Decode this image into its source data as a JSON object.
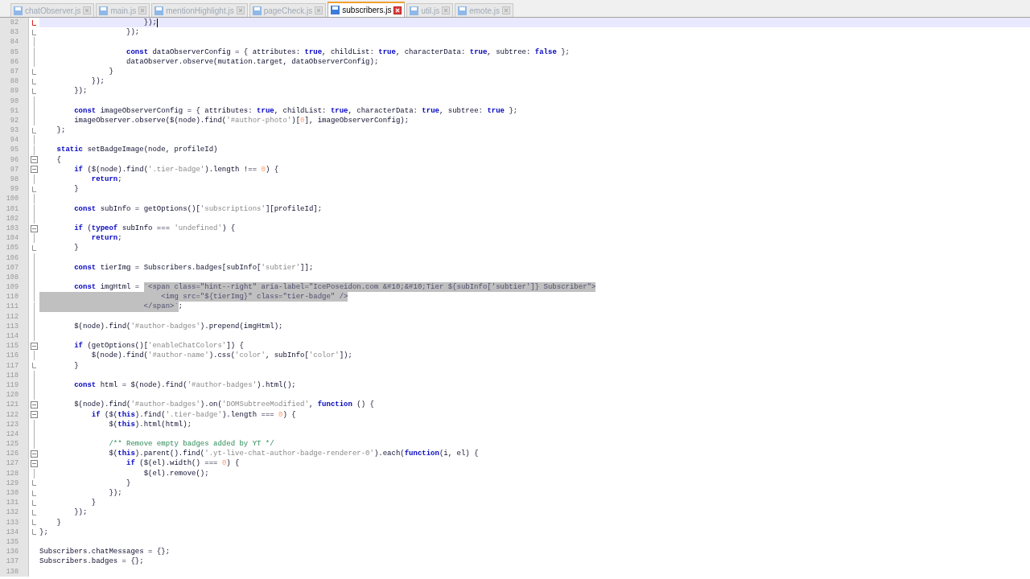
{
  "tabs": [
    {
      "label": "chatObserver.js",
      "selected": false
    },
    {
      "label": "main.js",
      "selected": false
    },
    {
      "label": "mentionHighlight.js",
      "selected": false
    },
    {
      "label": "pageCheck.js",
      "selected": false
    },
    {
      "label": "subscribers.js",
      "selected": true
    },
    {
      "label": "util.js",
      "selected": false
    },
    {
      "label": "emote.js",
      "selected": false
    }
  ],
  "editor": {
    "lines": [
      {
        "number": "82",
        "current": true,
        "kind": "changed-end",
        "code": [
          {
            "text": "                        });",
            "kind": "plain"
          }
        ]
      },
      {
        "number": "83",
        "current": false,
        "kind": "fold-end",
        "code": [
          {
            "text": "                    });",
            "kind": "plain"
          }
        ]
      },
      {
        "number": "84",
        "current": false,
        "kind": "fold-body"
      },
      {
        "number": "85",
        "current": false,
        "kind": "fold-body",
        "code": [
          {
            "text": "                    const",
            "kind": "keyword"
          },
          {
            "text": " dataObserverConfig = { attributes: ",
            "kind": "plain"
          },
          {
            "text": "true",
            "kind": "keyword"
          },
          {
            "text": ", childList: ",
            "kind": "plain"
          },
          {
            "text": "true",
            "kind": "keyword"
          },
          {
            "text": ", characterData: ",
            "kind": "plain"
          },
          {
            "text": "true",
            "kind": "keyword"
          },
          {
            "text": ", subtree: ",
            "kind": "plain"
          },
          {
            "text": "false",
            "kind": "keyword"
          },
          {
            "text": " };",
            "kind": "plain"
          }
        ]
      },
      {
        "number": "86",
        "current": false,
        "kind": "fold-body",
        "code": [
          {
            "text": "                    dataObserver.observe(mutation.target, dataObserverConfig);",
            "kind": "plain"
          }
        ]
      },
      {
        "number": "87",
        "current": false,
        "kind": "fold-end",
        "code": [
          {
            "text": "                }",
            "kind": "plain"
          }
        ]
      },
      {
        "number": "88",
        "current": false,
        "kind": "fold-end",
        "code": [
          {
            "text": "            });",
            "kind": "plain"
          }
        ]
      },
      {
        "number": "89",
        "current": false,
        "kind": "fold-end",
        "code": [
          {
            "text": "        });",
            "kind": "plain"
          }
        ]
      },
      {
        "number": "90",
        "current": false,
        "kind": "fold-body"
      },
      {
        "number": "91",
        "current": false,
        "kind": "fold-body",
        "code": [
          {
            "text": "        const",
            "kind": "keyword"
          },
          {
            "text": " imageObserverConfig = { attributes: ",
            "kind": "plain"
          },
          {
            "text": "true",
            "kind": "keyword"
          },
          {
            "text": ", childList: ",
            "kind": "plain"
          },
          {
            "text": "true",
            "kind": "keyword"
          },
          {
            "text": ", characterData: ",
            "kind": "plain"
          },
          {
            "text": "true",
            "kind": "keyword"
          },
          {
            "text": ", subtree: ",
            "kind": "plain"
          },
          {
            "text": "true",
            "kind": "keyword"
          },
          {
            "text": " };",
            "kind": "plain"
          }
        ]
      },
      {
        "number": "92",
        "current": false,
        "kind": "fold-body",
        "code": [
          {
            "text": "        imageObserver.observe($(node).find(",
            "kind": "plain"
          },
          {
            "text": "'#author-photo'",
            "kind": "string"
          },
          {
            "text": ")[",
            "kind": "plain"
          },
          {
            "text": "0",
            "kind": "number"
          },
          {
            "text": "], imageObserverConfig);",
            "kind": "plain"
          }
        ]
      },
      {
        "number": "93",
        "current": false,
        "kind": "fold-end",
        "code": [
          {
            "text": "    };",
            "kind": "plain"
          }
        ]
      },
      {
        "number": "94",
        "current": false,
        "kind": "fold-body"
      },
      {
        "number": "95",
        "current": false,
        "kind": "fold-body",
        "code": [
          {
            "text": "    static",
            "kind": "keyword"
          },
          {
            "text": " setBadgeImage(node, profileId)",
            "kind": "plain"
          }
        ]
      },
      {
        "number": "96",
        "current": false,
        "kind": "fold-start",
        "code": [
          {
            "text": "    {",
            "kind": "plain"
          }
        ]
      },
      {
        "number": "97",
        "current": false,
        "kind": "fold-start",
        "code": [
          {
            "text": "        if",
            "kind": "keyword"
          },
          {
            "text": " ($(node).find(",
            "kind": "plain"
          },
          {
            "text": "'.tier-badge'",
            "kind": "string"
          },
          {
            "text": ").length !== ",
            "kind": "plain"
          },
          {
            "text": "0",
            "kind": "number"
          },
          {
            "text": ") {",
            "kind": "plain"
          }
        ]
      },
      {
        "number": "98",
        "current": false,
        "kind": "fold-body",
        "code": [
          {
            "text": "            return",
            "kind": "keyword"
          },
          {
            "text": ";",
            "kind": "plain"
          }
        ]
      },
      {
        "number": "99",
        "current": false,
        "kind": "fold-end",
        "code": [
          {
            "text": "        }",
            "kind": "plain"
          }
        ]
      },
      {
        "number": "100",
        "current": false,
        "kind": "fold-body"
      },
      {
        "number": "101",
        "current": false,
        "kind": "fold-body",
        "code": [
          {
            "text": "        const",
            "kind": "keyword"
          },
          {
            "text": " subInfo = getOptions()[",
            "kind": "plain"
          },
          {
            "text": "'subscriptions'",
            "kind": "string"
          },
          {
            "text": "][profileId];",
            "kind": "plain"
          }
        ]
      },
      {
        "number": "102",
        "current": false,
        "kind": "fold-body"
      },
      {
        "number": "103",
        "current": false,
        "kind": "fold-start",
        "code": [
          {
            "text": "        if",
            "kind": "keyword"
          },
          {
            "text": " (",
            "kind": "plain"
          },
          {
            "text": "typeof",
            "kind": "keyword"
          },
          {
            "text": " subInfo === ",
            "kind": "plain"
          },
          {
            "text": "'undefined'",
            "kind": "string"
          },
          {
            "text": ") {",
            "kind": "plain"
          }
        ]
      },
      {
        "number": "104",
        "current": false,
        "kind": "fold-body",
        "code": [
          {
            "text": "            return",
            "kind": "keyword"
          },
          {
            "text": ";",
            "kind": "plain"
          }
        ]
      },
      {
        "number": "105",
        "current": false,
        "kind": "fold-end",
        "code": [
          {
            "text": "        }",
            "kind": "plain"
          }
        ]
      },
      {
        "number": "106",
        "current": false,
        "kind": "fold-body"
      },
      {
        "number": "107",
        "current": false,
        "kind": "fold-body",
        "code": [
          {
            "text": "        const",
            "kind": "keyword"
          },
          {
            "text": " tierImg = Subscribers.badges[subInfo[",
            "kind": "plain"
          },
          {
            "text": "'subtier'",
            "kind": "string"
          },
          {
            "text": "]];",
            "kind": "plain"
          }
        ]
      },
      {
        "number": "108",
        "current": false,
        "kind": "fold-body"
      },
      {
        "number": "109",
        "current": false,
        "kind": "fold-body",
        "code": [
          {
            "text": "        const",
            "kind": "keyword"
          },
          {
            "text": " imgHtml = ",
            "kind": "plain"
          },
          {
            "text": "`<span class=\"hint--right\" aria-label=\"IcePoseidon.com &#10;&#10;Tier ${subInfo['subtier']} Subscriber\">",
            "kind": "selection"
          }
        ]
      },
      {
        "number": "110",
        "current": false,
        "kind": "fold-body",
        "code": [
          {
            "text": "                            <img src=\"${tierImg}\" class=\"tier-badge\" />",
            "kind": "selection"
          }
        ]
      },
      {
        "number": "111",
        "current": false,
        "kind": "fold-body",
        "code": [
          {
            "text": "                        </span>`",
            "kind": "selection"
          },
          {
            "text": ";",
            "kind": "plain"
          }
        ]
      },
      {
        "number": "112",
        "current": false,
        "kind": "fold-body"
      },
      {
        "number": "113",
        "current": false,
        "kind": "fold-body",
        "code": [
          {
            "text": "        $(node).find(",
            "kind": "plain"
          },
          {
            "text": "'#author-badges'",
            "kind": "string"
          },
          {
            "text": ").prepend(imgHtml);",
            "kind": "plain"
          }
        ]
      },
      {
        "number": "114",
        "current": false,
        "kind": "fold-body"
      },
      {
        "number": "115",
        "current": false,
        "kind": "fold-start",
        "code": [
          {
            "text": "        if",
            "kind": "keyword"
          },
          {
            "text": " (getOptions()[",
            "kind": "plain"
          },
          {
            "text": "'enableChatColors'",
            "kind": "string"
          },
          {
            "text": "]) {",
            "kind": "plain"
          }
        ]
      },
      {
        "number": "116",
        "current": false,
        "kind": "fold-body",
        "code": [
          {
            "text": "            $(node).find(",
            "kind": "plain"
          },
          {
            "text": "'#author-name'",
            "kind": "string"
          },
          {
            "text": ").css(",
            "kind": "plain"
          },
          {
            "text": "'color'",
            "kind": "string"
          },
          {
            "text": ", subInfo[",
            "kind": "plain"
          },
          {
            "text": "'color'",
            "kind": "string"
          },
          {
            "text": "]);",
            "kind": "plain"
          }
        ]
      },
      {
        "number": "117",
        "current": false,
        "kind": "fold-end",
        "code": [
          {
            "text": "        }",
            "kind": "plain"
          }
        ]
      },
      {
        "number": "118",
        "current": false,
        "kind": "fold-body"
      },
      {
        "number": "119",
        "current": false,
        "kind": "fold-body",
        "code": [
          {
            "text": "        const",
            "kind": "keyword"
          },
          {
            "text": " html = $(node).find(",
            "kind": "plain"
          },
          {
            "text": "'#author-badges'",
            "kind": "string"
          },
          {
            "text": ").html();",
            "kind": "plain"
          }
        ]
      },
      {
        "number": "120",
        "current": false,
        "kind": "fold-body"
      },
      {
        "number": "121",
        "current": false,
        "kind": "fold-start",
        "code": [
          {
            "text": "        $(node).find(",
            "kind": "plain"
          },
          {
            "text": "'#author-badges'",
            "kind": "string"
          },
          {
            "text": ").on(",
            "kind": "plain"
          },
          {
            "text": "'DOMSubtreeModified'",
            "kind": "string"
          },
          {
            "text": ", ",
            "kind": "plain"
          },
          {
            "text": "function",
            "kind": "keyword"
          },
          {
            "text": " () {",
            "kind": "plain"
          }
        ]
      },
      {
        "number": "122",
        "current": false,
        "kind": "fold-start",
        "code": [
          {
            "text": "            if",
            "kind": "keyword"
          },
          {
            "text": " ($(",
            "kind": "plain"
          },
          {
            "text": "this",
            "kind": "keyword"
          },
          {
            "text": ").find(",
            "kind": "plain"
          },
          {
            "text": "'.tier-badge'",
            "kind": "string"
          },
          {
            "text": ").length === ",
            "kind": "plain"
          },
          {
            "text": "0",
            "kind": "number"
          },
          {
            "text": ") {",
            "kind": "plain"
          }
        ]
      },
      {
        "number": "123",
        "current": false,
        "kind": "fold-body",
        "code": [
          {
            "text": "                $(",
            "kind": "plain"
          },
          {
            "text": "this",
            "kind": "keyword"
          },
          {
            "text": ").html(html);",
            "kind": "plain"
          }
        ]
      },
      {
        "number": "124",
        "current": false,
        "kind": "fold-body"
      },
      {
        "number": "125",
        "current": false,
        "kind": "fold-body",
        "code": [
          {
            "text": "                /** Remove empty badges added by YT */",
            "kind": "comment"
          }
        ]
      },
      {
        "number": "126",
        "current": false,
        "kind": "fold-start",
        "code": [
          {
            "text": "                $(",
            "kind": "plain"
          },
          {
            "text": "this",
            "kind": "keyword"
          },
          {
            "text": ").parent().find(",
            "kind": "plain"
          },
          {
            "text": "'.yt-live-chat-author-badge-renderer-0'",
            "kind": "string"
          },
          {
            "text": ").each(",
            "kind": "plain"
          },
          {
            "text": "function",
            "kind": "keyword"
          },
          {
            "text": "(i, el) {",
            "kind": "plain"
          }
        ]
      },
      {
        "number": "127",
        "current": false,
        "kind": "fold-start",
        "code": [
          {
            "text": "                    if",
            "kind": "keyword"
          },
          {
            "text": " ($(el).width() === ",
            "kind": "plain"
          },
          {
            "text": "0",
            "kind": "number"
          },
          {
            "text": ") {",
            "kind": "plain"
          }
        ]
      },
      {
        "number": "128",
        "current": false,
        "kind": "fold-body",
        "code": [
          {
            "text": "                        $(el).remove();",
            "kind": "plain"
          }
        ]
      },
      {
        "number": "129",
        "current": false,
        "kind": "fold-end",
        "code": [
          {
            "text": "                    }",
            "kind": "plain"
          }
        ]
      },
      {
        "number": "130",
        "current": false,
        "kind": "fold-end",
        "code": [
          {
            "text": "                });",
            "kind": "plain"
          }
        ]
      },
      {
        "number": "131",
        "current": false,
        "kind": "fold-end",
        "code": [
          {
            "text": "            }",
            "kind": "plain"
          }
        ]
      },
      {
        "number": "132",
        "current": false,
        "kind": "fold-end",
        "code": [
          {
            "text": "        });",
            "kind": "plain"
          }
        ]
      },
      {
        "number": "133",
        "current": false,
        "kind": "fold-end",
        "code": [
          {
            "text": "    }",
            "kind": "plain"
          }
        ]
      },
      {
        "number": "134",
        "current": false,
        "kind": "fold-end",
        "code": [
          {
            "text": "};",
            "kind": "plain"
          }
        ]
      },
      {
        "number": "135",
        "current": false,
        "kind": "plain"
      },
      {
        "number": "136",
        "current": false,
        "kind": "plain",
        "code": [
          {
            "text": "Subscribers.chatMessages = {};",
            "kind": "plain"
          }
        ]
      },
      {
        "number": "137",
        "current": false,
        "kind": "plain",
        "code": [
          {
            "text": "Subscribers.badges = {};",
            "kind": "plain"
          }
        ]
      },
      {
        "number": "138",
        "current": false,
        "kind": "plain"
      }
    ]
  }
}
